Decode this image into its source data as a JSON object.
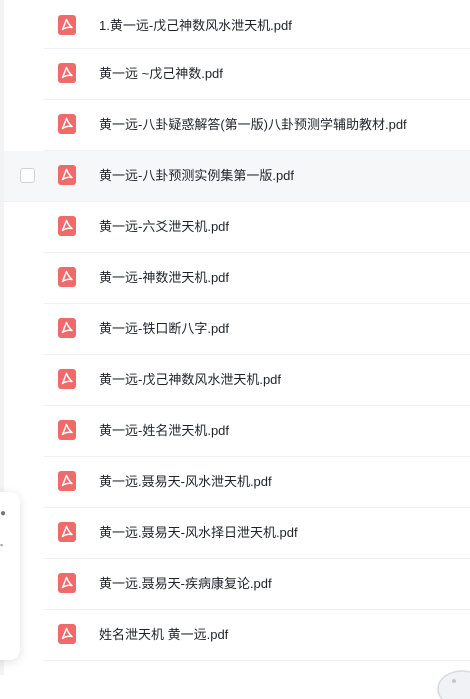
{
  "files": [
    {
      "name": "1.黄一远-戊己神数风水泄天机.pdf",
      "icon": "pdf-file-icon"
    },
    {
      "name": "黄一远 ~戊己神数.pdf",
      "icon": "pdf-file-icon"
    },
    {
      "name": "黄一远-八卦疑惑解答(第一版)八卦预测学辅助教材.pdf",
      "icon": "pdf-file-icon"
    },
    {
      "name": "黄一远-八卦预测实例集第一版.pdf",
      "icon": "pdf-file-icon",
      "hovered": true
    },
    {
      "name": "黄一远-六爻泄天机.pdf",
      "icon": "pdf-file-icon"
    },
    {
      "name": "黄一远-神数泄天机.pdf",
      "icon": "pdf-file-icon"
    },
    {
      "name": "黄一远-铁口断八字.pdf",
      "icon": "pdf-file-icon"
    },
    {
      "name": "黄一远-戊己神数风水泄天机.pdf",
      "icon": "pdf-file-icon"
    },
    {
      "name": "黄一远-姓名泄天机.pdf",
      "icon": "pdf-file-icon"
    },
    {
      "name": "黄一远.聂易天-风水泄天机.pdf",
      "icon": "pdf-file-icon"
    },
    {
      "name": "黄一远.聂易天-风水择日泄天机.pdf",
      "icon": "pdf-file-icon"
    },
    {
      "name": "黄一远.聂易天-疾病康复论.pdf",
      "icon": "pdf-file-icon"
    },
    {
      "name": "姓名泄天机 黄一远.pdf",
      "icon": "pdf-file-icon"
    }
  ],
  "colors": {
    "pdf_icon": "#f06a6a",
    "divider": "#eef0f3",
    "hover_bg": "#f6f7f9",
    "text": "#1f2329"
  }
}
